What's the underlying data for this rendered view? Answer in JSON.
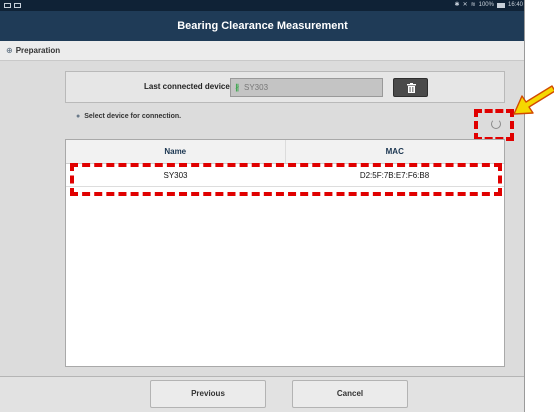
{
  "status_bar": {
    "left_icons": [
      "gallery-icon",
      "image-icon"
    ],
    "right_text": "100%",
    "time": "16:40",
    "right_icons": [
      "bluetooth-icon",
      "mute-icon",
      "signal-icon",
      "battery-icon"
    ]
  },
  "app_bar": {
    "title": "Bearing Clearance Measurement"
  },
  "section": {
    "bullet": "⊕",
    "title": "Preparation"
  },
  "last_connected": {
    "label": "Last connected device",
    "device_icon": "bluetooth-icon",
    "value": "SY303",
    "delete_icon": "trash-icon"
  },
  "device_list": {
    "instruction_bullet": "●",
    "instruction": "Select device for connection.",
    "columns": [
      "Name",
      "MAC"
    ],
    "rows": [
      {
        "name": "SY303",
        "mac": "D2:5F:7B:E7:F6:B8"
      }
    ]
  },
  "footer": {
    "previous": "Previous",
    "cancel": "Cancel"
  },
  "colors": {
    "app_bar": "#1f3b57",
    "status_bar": "#0f2236",
    "highlight": "#e00000",
    "arrow": "#f5d800"
  }
}
